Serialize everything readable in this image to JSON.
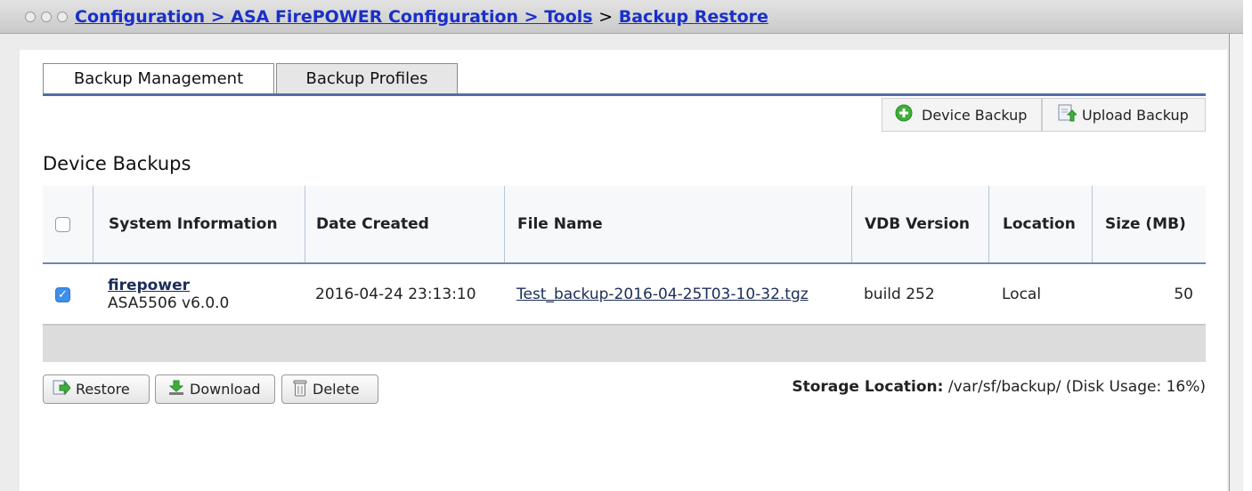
{
  "breadcrumb": {
    "part1": "Configuration > ASA FirePOWER Configuration > Tools",
    "separator": ">",
    "part2": "Backup Restore"
  },
  "tabs": [
    {
      "label": "Backup Management",
      "active": true
    },
    {
      "label": "Backup Profiles",
      "active": false
    }
  ],
  "toolbar": {
    "device_backup": "Device Backup",
    "upload_backup": "Upload Backup"
  },
  "section_title": "Device Backups",
  "table": {
    "columns": [
      "System Information",
      "Date Created",
      "File Name",
      "VDB Version",
      "Location",
      "Size (MB)"
    ],
    "rows": [
      {
        "checked": true,
        "system_name": "firepower",
        "system_model": "ASA5506 v6.0.0",
        "date_created": "2016-04-24 23:13:10",
        "file_name": "Test_backup-2016-04-25T03-10-32.tgz",
        "vdb_version": "build 252",
        "location": "Local",
        "size": "50"
      }
    ]
  },
  "actions": {
    "restore": "Restore",
    "download": "Download",
    "delete": "Delete"
  },
  "storage": {
    "label": "Storage Location:",
    "value": "/var/sf/backup/ (Disk Usage: 16%)"
  },
  "colors": {
    "link": "#1a2fc9",
    "tab_rule": "#4e6fa6",
    "checkbox": "#3d8fe8"
  }
}
